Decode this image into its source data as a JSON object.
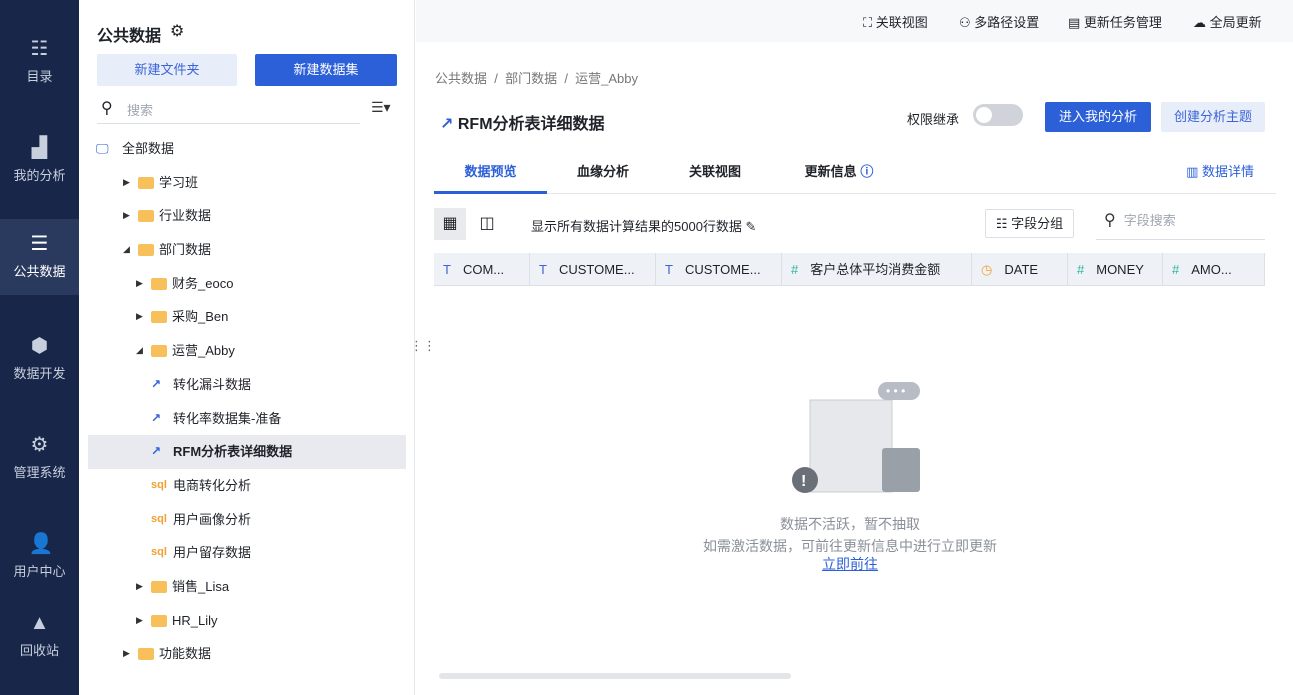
{
  "nav": [
    {
      "label": "目录",
      "icon": "catalog-icon"
    },
    {
      "label": "我的分析",
      "icon": "chart-icon"
    },
    {
      "label": "公共数据",
      "icon": "public-data-icon",
      "active": true
    },
    {
      "label": "数据开发",
      "icon": "cube-icon"
    },
    {
      "label": "管理系统",
      "icon": "gear-icon"
    },
    {
      "label": "用户中心",
      "icon": "user-icon"
    },
    {
      "label": "回收站",
      "icon": "recycle-icon"
    }
  ],
  "sidebar": {
    "title": "公共数据",
    "new_folder": "新建文件夹",
    "new_dataset": "新建数据集",
    "search_placeholder": "搜索",
    "tree": [
      {
        "label": "全部数据",
        "level": 0,
        "type": "root"
      },
      {
        "label": "学习班",
        "level": 1,
        "type": "folder"
      },
      {
        "label": "行业数据",
        "level": 1,
        "type": "folder"
      },
      {
        "label": "部门数据",
        "level": 1,
        "type": "folder",
        "open": true
      },
      {
        "label": "财务_eoco",
        "level": 2,
        "type": "folder"
      },
      {
        "label": "采购_Ben",
        "level": 2,
        "type": "folder"
      },
      {
        "label": "运营_Abby",
        "level": 2,
        "type": "folder",
        "open": true
      },
      {
        "label": "转化漏斗数据",
        "level": 3,
        "type": "dataset"
      },
      {
        "label": "转化率数据集-准备",
        "level": 3,
        "type": "dataset"
      },
      {
        "label": "RFM分析表详细数据",
        "level": 3,
        "type": "dataset",
        "selected": true
      },
      {
        "label": "电商转化分析",
        "level": 3,
        "type": "sql"
      },
      {
        "label": "用户画像分析",
        "level": 3,
        "type": "sql"
      },
      {
        "label": "用户留存数据",
        "level": 3,
        "type": "sql"
      },
      {
        "label": "销售_Lisa",
        "level": 2,
        "type": "folder"
      },
      {
        "label": "HR_Lily",
        "level": 2,
        "type": "folder"
      },
      {
        "label": "功能数据",
        "level": 1,
        "type": "folder"
      }
    ]
  },
  "toolbar": [
    "关联视图",
    "多路径设置",
    "更新任务管理",
    "全局更新"
  ],
  "breadcrumb": [
    "公共数据",
    "部门数据",
    "运营_Abby"
  ],
  "title": "RFM分析表详细数据",
  "perm_label": "权限继承",
  "enter_analysis": "进入我的分析",
  "create_topic": "创建分析主题",
  "tabs": [
    "数据预览",
    "血缘分析",
    "关联视图",
    "更新信息"
  ],
  "data_detail": "数据详情",
  "hint": "显示所有数据计算结果的5000行数据",
  "field_group": "字段分组",
  "field_search_placeholder": "字段搜索",
  "columns": [
    {
      "type": "T",
      "name": "COM..."
    },
    {
      "type": "T",
      "name": "CUSTOME..."
    },
    {
      "type": "T",
      "name": "CUSTOME..."
    },
    {
      "type": "#",
      "name": "客户总体平均消费金额"
    },
    {
      "type": "◷",
      "name": "DATE"
    },
    {
      "type": "#",
      "name": "MONEY"
    },
    {
      "type": "#",
      "name": "AMO..."
    }
  ],
  "empty": {
    "line1": "数据不活跃，暂不抽取",
    "line2": "如需激活数据，可前往更新信息中进行立即更新",
    "link": "立即前往"
  }
}
